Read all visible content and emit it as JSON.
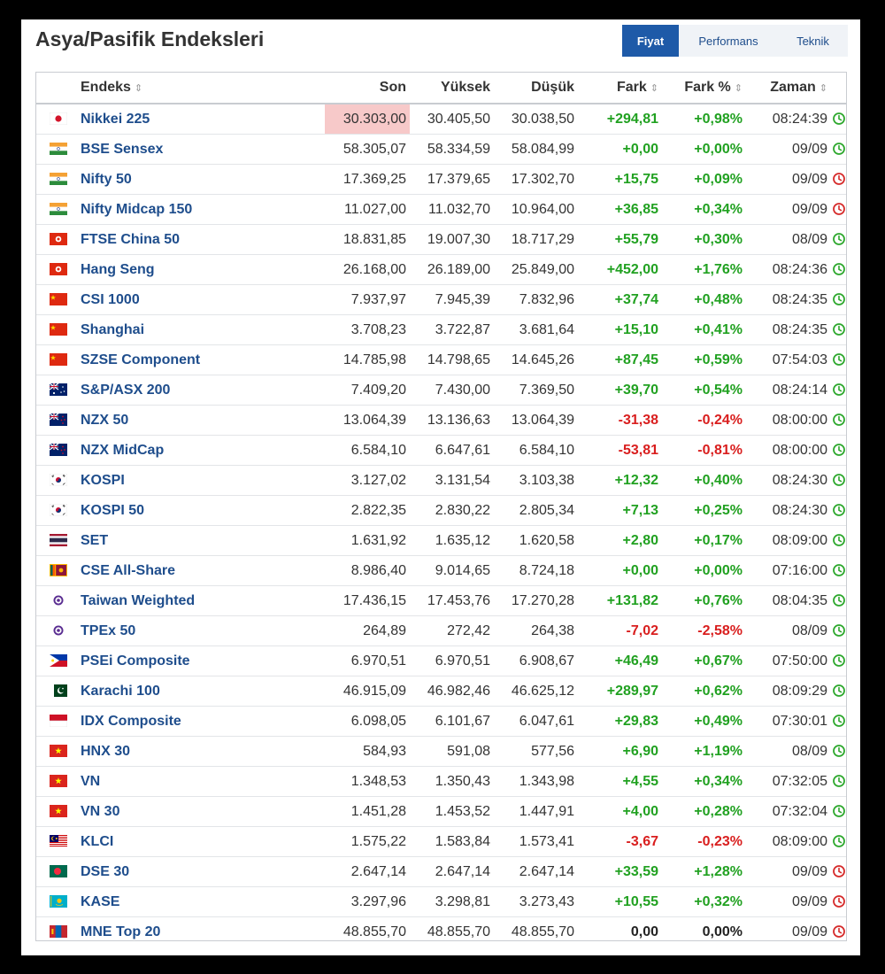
{
  "title": "Asya/Pasifik Endeksleri",
  "tabs": [
    {
      "label": "Fiyat",
      "active": true
    },
    {
      "label": "Performans",
      "active": false
    },
    {
      "label": "Teknik",
      "active": false
    }
  ],
  "columns": {
    "name": "Endeks",
    "last": "Son",
    "high": "Yüksek",
    "low": "Düşük",
    "change": "Fark",
    "change_pct": "Fark %",
    "time": "Zaman"
  },
  "colors": {
    "positive": "#21a121",
    "negative": "#d91e1e",
    "clock_open": "#2ea82e",
    "clock_closed": "#d62b2b",
    "tab_active": "#1e5aa8",
    "link": "#1e4d8c",
    "highlight": "#f7c9c9"
  },
  "rows": [
    {
      "flag": "japan-flag-icon",
      "name": "Nikkei 225",
      "last": "30.303,00",
      "high": "30.405,50",
      "low": "30.038,50",
      "change": "+294,81",
      "change_pct": "+0,98%",
      "time": "08:24:39",
      "status": "open",
      "highlight": true
    },
    {
      "flag": "india-flag-icon",
      "name": "BSE Sensex",
      "last": "58.305,07",
      "high": "58.334,59",
      "low": "58.084,99",
      "change": "+0,00",
      "change_pct": "+0,00%",
      "time": "09/09",
      "status": "open"
    },
    {
      "flag": "india-flag-icon",
      "name": "Nifty 50",
      "last": "17.369,25",
      "high": "17.379,65",
      "low": "17.302,70",
      "change": "+15,75",
      "change_pct": "+0,09%",
      "time": "09/09",
      "status": "closed"
    },
    {
      "flag": "india-flag-icon",
      "name": "Nifty Midcap 150",
      "last": "11.027,00",
      "high": "11.032,70",
      "low": "10.964,00",
      "change": "+36,85",
      "change_pct": "+0,34%",
      "time": "09/09",
      "status": "closed"
    },
    {
      "flag": "hong-kong-flag-icon",
      "name": "FTSE China 50",
      "last": "18.831,85",
      "high": "19.007,30",
      "low": "18.717,29",
      "change": "+55,79",
      "change_pct": "+0,30%",
      "time": "08/09",
      "status": "open"
    },
    {
      "flag": "hong-kong-flag-icon",
      "name": "Hang Seng",
      "last": "26.168,00",
      "high": "26.189,00",
      "low": "25.849,00",
      "change": "+452,00",
      "change_pct": "+1,76%",
      "time": "08:24:36",
      "status": "open"
    },
    {
      "flag": "china-flag-icon",
      "name": "CSI 1000",
      "last": "7.937,97",
      "high": "7.945,39",
      "low": "7.832,96",
      "change": "+37,74",
      "change_pct": "+0,48%",
      "time": "08:24:35",
      "status": "open"
    },
    {
      "flag": "china-flag-icon",
      "name": "Shanghai",
      "last": "3.708,23",
      "high": "3.722,87",
      "low": "3.681,64",
      "change": "+15,10",
      "change_pct": "+0,41%",
      "time": "08:24:35",
      "status": "open"
    },
    {
      "flag": "china-flag-icon",
      "name": "SZSE Component",
      "last": "14.785,98",
      "high": "14.798,65",
      "low": "14.645,26",
      "change": "+87,45",
      "change_pct": "+0,59%",
      "time": "07:54:03",
      "status": "open"
    },
    {
      "flag": "australia-flag-icon",
      "name": "S&P/ASX 200",
      "last": "7.409,20",
      "high": "7.430,00",
      "low": "7.369,50",
      "change": "+39,70",
      "change_pct": "+0,54%",
      "time": "08:24:14",
      "status": "open"
    },
    {
      "flag": "new-zealand-flag-icon",
      "name": "NZX 50",
      "last": "13.064,39",
      "high": "13.136,63",
      "low": "13.064,39",
      "change": "-31,38",
      "change_pct": "-0,24%",
      "time": "08:00:00",
      "status": "open"
    },
    {
      "flag": "new-zealand-flag-icon",
      "name": "NZX MidCap",
      "last": "6.584,10",
      "high": "6.647,61",
      "low": "6.584,10",
      "change": "-53,81",
      "change_pct": "-0,81%",
      "time": "08:00:00",
      "status": "open"
    },
    {
      "flag": "south-korea-flag-icon",
      "name": "KOSPI",
      "last": "3.127,02",
      "high": "3.131,54",
      "low": "3.103,38",
      "change": "+12,32",
      "change_pct": "+0,40%",
      "time": "08:24:30",
      "status": "open"
    },
    {
      "flag": "south-korea-flag-icon",
      "name": "KOSPI 50",
      "last": "2.822,35",
      "high": "2.830,22",
      "low": "2.805,34",
      "change": "+7,13",
      "change_pct": "+0,25%",
      "time": "08:24:30",
      "status": "open"
    },
    {
      "flag": "thailand-flag-icon",
      "name": "SET",
      "last": "1.631,92",
      "high": "1.635,12",
      "low": "1.620,58",
      "change": "+2,80",
      "change_pct": "+0,17%",
      "time": "08:09:00",
      "status": "open"
    },
    {
      "flag": "sri-lanka-flag-icon",
      "name": "CSE All-Share",
      "last": "8.986,40",
      "high": "9.014,65",
      "low": "8.724,18",
      "change": "+0,00",
      "change_pct": "+0,00%",
      "time": "07:16:00",
      "status": "open"
    },
    {
      "flag": "taiwan-flag-icon",
      "name": "Taiwan Weighted",
      "last": "17.436,15",
      "high": "17.453,76",
      "low": "17.270,28",
      "change": "+131,82",
      "change_pct": "+0,76%",
      "time": "08:04:35",
      "status": "open"
    },
    {
      "flag": "taiwan-flag-icon",
      "name": "TPEx 50",
      "last": "264,89",
      "high": "272,42",
      "low": "264,38",
      "change": "-7,02",
      "change_pct": "-2,58%",
      "time": "08/09",
      "status": "open"
    },
    {
      "flag": "philippines-flag-icon",
      "name": "PSEi Composite",
      "last": "6.970,51",
      "high": "6.970,51",
      "low": "6.908,67",
      "change": "+46,49",
      "change_pct": "+0,67%",
      "time": "07:50:00",
      "status": "open"
    },
    {
      "flag": "pakistan-flag-icon",
      "name": "Karachi 100",
      "last": "46.915,09",
      "high": "46.982,46",
      "low": "46.625,12",
      "change": "+289,97",
      "change_pct": "+0,62%",
      "time": "08:09:29",
      "status": "open"
    },
    {
      "flag": "indonesia-flag-icon",
      "name": "IDX Composite",
      "last": "6.098,05",
      "high": "6.101,67",
      "low": "6.047,61",
      "change": "+29,83",
      "change_pct": "+0,49%",
      "time": "07:30:01",
      "status": "open"
    },
    {
      "flag": "vietnam-flag-icon",
      "name": "HNX 30",
      "last": "584,93",
      "high": "591,08",
      "low": "577,56",
      "change": "+6,90",
      "change_pct": "+1,19%",
      "time": "08/09",
      "status": "open"
    },
    {
      "flag": "vietnam-flag-icon",
      "name": "VN",
      "last": "1.348,53",
      "high": "1.350,43",
      "low": "1.343,98",
      "change": "+4,55",
      "change_pct": "+0,34%",
      "time": "07:32:05",
      "status": "open"
    },
    {
      "flag": "vietnam-flag-icon",
      "name": "VN 30",
      "last": "1.451,28",
      "high": "1.453,52",
      "low": "1.447,91",
      "change": "+4,00",
      "change_pct": "+0,28%",
      "time": "07:32:04",
      "status": "open"
    },
    {
      "flag": "malaysia-flag-icon",
      "name": "KLCI",
      "last": "1.575,22",
      "high": "1.583,84",
      "low": "1.573,41",
      "change": "-3,67",
      "change_pct": "-0,23%",
      "time": "08:09:00",
      "status": "open"
    },
    {
      "flag": "bangladesh-flag-icon",
      "name": "DSE 30",
      "last": "2.647,14",
      "high": "2.647,14",
      "low": "2.647,14",
      "change": "+33,59",
      "change_pct": "+1,28%",
      "time": "09/09",
      "status": "closed"
    },
    {
      "flag": "kazakhstan-flag-icon",
      "name": "KASE",
      "last": "3.297,96",
      "high": "3.298,81",
      "low": "3.273,43",
      "change": "+10,55",
      "change_pct": "+0,32%",
      "time": "09/09",
      "status": "closed"
    },
    {
      "flag": "mongolia-flag-icon",
      "name": "MNE Top 20",
      "last": "48.855,70",
      "high": "48.855,70",
      "low": "48.855,70",
      "change": "0,00",
      "change_pct": "0,00%",
      "time": "09/09",
      "status": "closed"
    }
  ]
}
